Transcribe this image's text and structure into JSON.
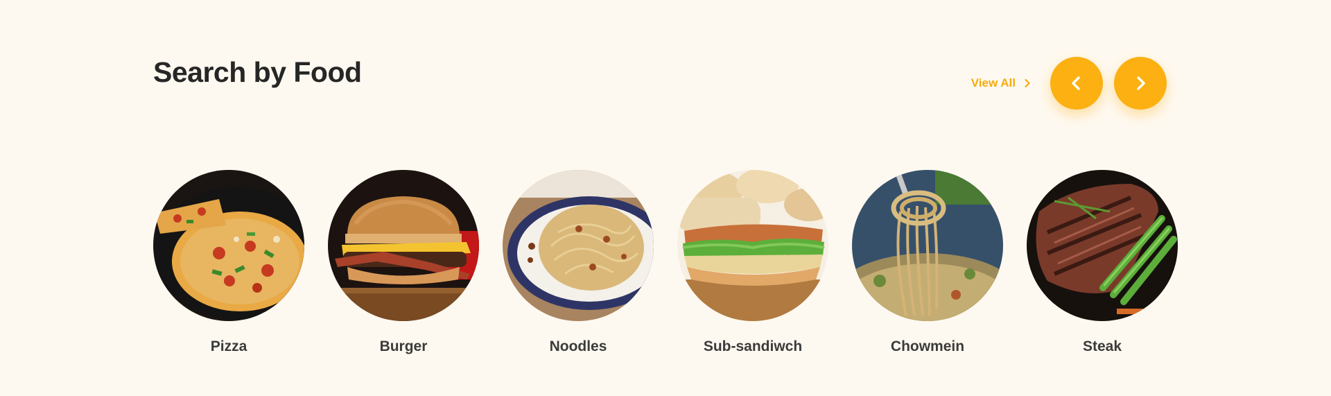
{
  "section": {
    "title": "Search by Food",
    "view_all_label": "View All"
  },
  "colors": {
    "background": "#fef9f0",
    "accent": "#fcb011",
    "title": "#262626"
  },
  "icons": {
    "prev": "chevron-left-icon",
    "next": "chevron-right-icon",
    "view_all": "chevron-right-icon"
  },
  "foods": [
    {
      "name": "Pizza"
    },
    {
      "name": "Burger"
    },
    {
      "name": "Noodles"
    },
    {
      "name": "Sub-sandiwch"
    },
    {
      "name": "Chowmein"
    },
    {
      "name": "Steak"
    }
  ]
}
